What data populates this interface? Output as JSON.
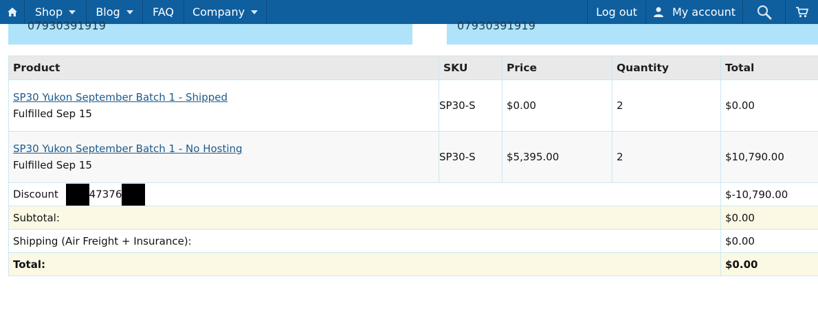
{
  "nav": {
    "home_icon": "home-icon",
    "shop": "Shop",
    "blog": "Blog",
    "faq": "FAQ",
    "company": "Company",
    "logout": "Log out",
    "account": "My account",
    "search_icon": "search-icon",
    "cart_icon": "cart-icon"
  },
  "addresses": {
    "billing_phone": "07930391919",
    "shipping_phone": "07930391919"
  },
  "table": {
    "headers": [
      "Product",
      "SKU",
      "Price",
      "Quantity",
      "Total"
    ],
    "items": [
      {
        "product": "SP30 Yukon September Batch 1 - Shipped",
        "status": "Fulfilled Sep 15",
        "sku": "SP30-S",
        "price": "$0.00",
        "quantity": "2",
        "total": "$0.00"
      },
      {
        "product": "SP30 Yukon September Batch 1 - No Hosting",
        "status": "Fulfilled Sep 15",
        "sku": "SP30-S",
        "price": "$5,395.00",
        "quantity": "2",
        "total": "$10,790.00"
      }
    ],
    "discount": {
      "label": "Discount",
      "code_visible": "47376",
      "value": "$-10,790.00"
    },
    "subtotal": {
      "label": "Subtotal:",
      "value": "$0.00"
    },
    "shipping": {
      "label": "Shipping (Air Freight + Insurance):",
      "value": "$0.00"
    },
    "total": {
      "label": "Total:",
      "value": "$0.00"
    }
  },
  "colors": {
    "nav_bg": "#0f5f9f",
    "address_bg": "#aee3fa",
    "header_bg": "#e9e9e9",
    "summary_highlight": "#fbf9e4",
    "link": "#1c5a8c"
  }
}
